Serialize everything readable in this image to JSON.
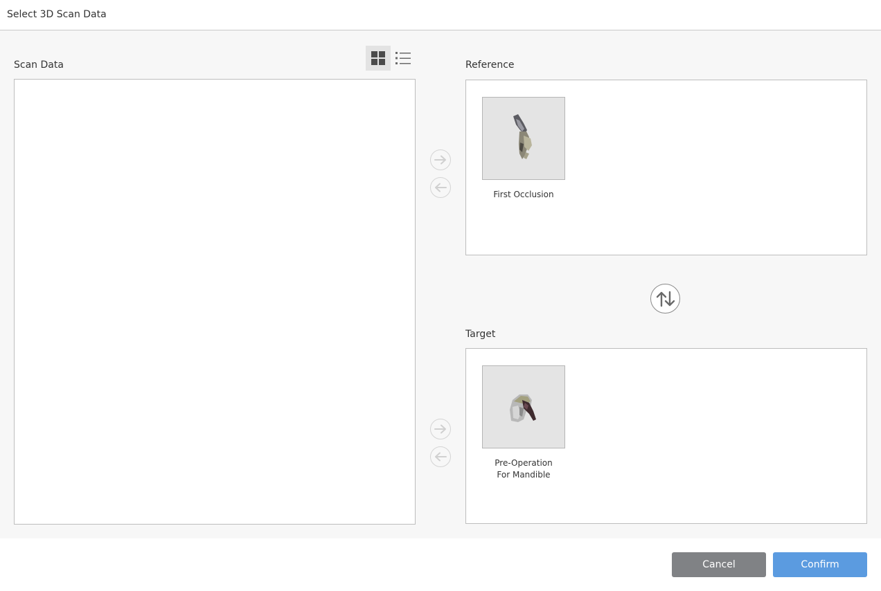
{
  "window": {
    "title": "Select 3D Scan Data"
  },
  "scan_data": {
    "label": "Scan Data",
    "view_modes": [
      {
        "icon": "grid-view-icon",
        "active": true
      },
      {
        "icon": "list-view-icon",
        "active": false
      }
    ],
    "items": []
  },
  "reference": {
    "label": "Reference",
    "items": [
      {
        "caption": "First Occlusion",
        "thumbnail": "occlusion-scan-thumbnail"
      }
    ]
  },
  "target": {
    "label": "Target",
    "items": [
      {
        "caption": "Pre-Operation\nFor Mandible",
        "thumbnail": "mandible-scan-thumbnail"
      }
    ]
  },
  "controls": {
    "move_right_icon": "arrow-right-icon",
    "move_left_icon": "arrow-left-icon",
    "swap_icon": "swap-vertical-icon"
  },
  "footer": {
    "cancel_label": "Cancel",
    "confirm_label": "Confirm"
  },
  "colors": {
    "cancel_button": "#808285",
    "confirm_button": "#5b9be0",
    "panel_background": "#f7f7f7",
    "disabled_icon": "#d4d4d4"
  }
}
